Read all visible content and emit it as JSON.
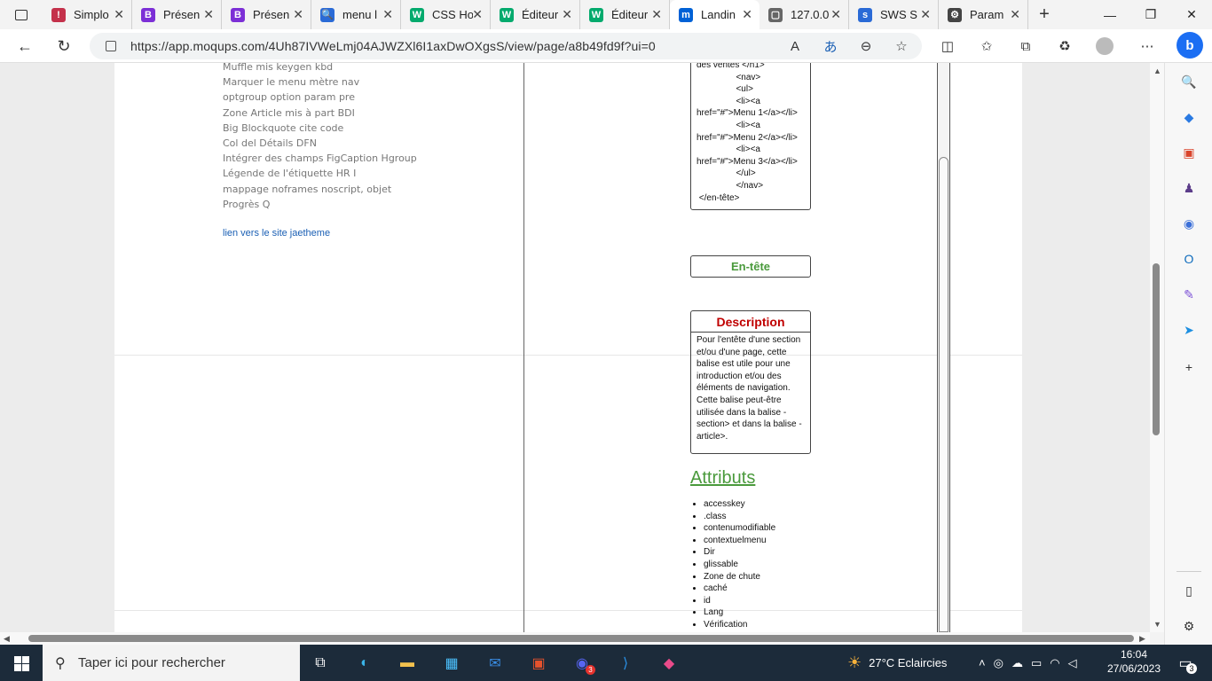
{
  "browser": {
    "tabs": [
      {
        "title": "Simplo",
        "icon": "alert-icon",
        "color": "#c4314b",
        "glyph": "!"
      },
      {
        "title": "Présen",
        "icon": "bootstrap-icon",
        "color": "#7c2fd6",
        "glyph": "B"
      },
      {
        "title": "Présen",
        "icon": "bootstrap-icon",
        "color": "#7c2fd6",
        "glyph": "B"
      },
      {
        "title": "menu l",
        "icon": "search-icon",
        "color": "#2a6ad6",
        "glyph": "🔍"
      },
      {
        "title": "CSS Ho",
        "icon": "w3schools-icon",
        "color": "#04aa6d",
        "glyph": "W"
      },
      {
        "title": "Éditeur",
        "icon": "w3schools-icon",
        "color": "#04aa6d",
        "glyph": "W"
      },
      {
        "title": "Éditeur",
        "icon": "w3schools-icon",
        "color": "#04aa6d",
        "glyph": "W"
      },
      {
        "title": "Landin",
        "icon": "moqups-icon",
        "color": "#0061d6",
        "glyph": "m",
        "active": true
      },
      {
        "title": "127.0.0",
        "icon": "page-icon",
        "color": "#666666",
        "glyph": "▢"
      },
      {
        "title": "SWS S",
        "icon": "sws-icon",
        "color": "#2a6ad6",
        "glyph": "s"
      },
      {
        "title": "Param",
        "icon": "gear-icon",
        "color": "#444444",
        "glyph": "⚙"
      }
    ],
    "url": "https://app.moqups.com/4Uh87IVWeLmj04AJWZXl6I1axDwOXgsS/view/page/a8b49fd9f?ui=0"
  },
  "page": {
    "left_items": [
      "Muffle mis keygen kbd",
      "Marquer le menu mètre nav",
      "optgroup option param pre",
      "Zone Article mis à part BDI",
      "Big Blockquote cite code",
      "Col del Détails DFN",
      "Intégrer des champs FigCaption Hgroup",
      "Légende de l'étiquette HR I",
      "mappage noframes noscript, objet",
      "Progrès Q"
    ],
    "link_text": "lien vers le site jaetheme",
    "code_lines": [
      "des ventes </h1>",
      "                <nav>",
      "                <ul>",
      "                <li><a",
      "href=\"#\">Menu 1</a></li>",
      "                <li><a",
      "href=\"#\">Menu 2</a></li>",
      "                <li><a",
      "href=\"#\">Menu 3</a></li>",
      "                </ul>",
      "                </nav>",
      " </en-tête>"
    ],
    "header_label": "En-tête",
    "description_title": "Description",
    "description_text": "Pour l'entête d'une section et/ou d'une page, cette balise est utile pour une introduction et/ou des éléments de navigation. Cette balise peut-être utilisée dans la balise -section> et dans la balise -article>.",
    "attributes_title": "Attributs",
    "attributes": [
      "accesskey",
      ".class",
      "contenumodifiable",
      "contextuelmenu",
      "Dir",
      "glissable",
      "Zone de chute",
      "caché",
      "id",
      "Lang",
      "Vérification"
    ]
  },
  "taskbar": {
    "search_placeholder": "Taper ici pour rechercher",
    "weather": "27°C  Eclaircies",
    "time": "16:04",
    "date": "27/06/2023",
    "notifications": "3",
    "discord_badge": "3"
  }
}
